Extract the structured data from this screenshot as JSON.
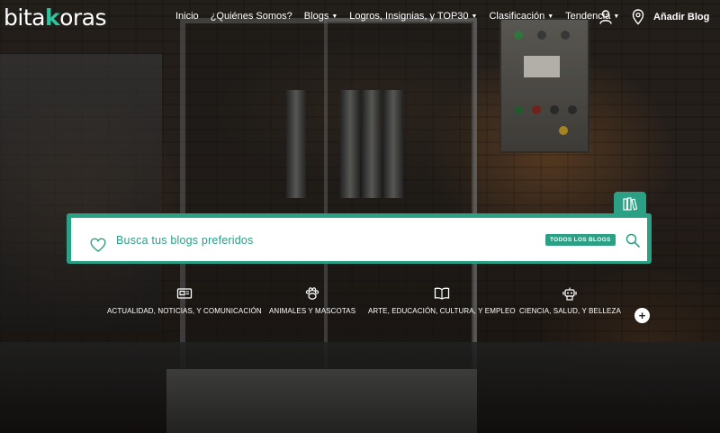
{
  "brand": {
    "logo_prefix": "bita",
    "logo_accent": "k",
    "logo_suffix": "oras",
    "accent_color": "#2ba084"
  },
  "nav": {
    "items": [
      {
        "label": "Inicio",
        "has_dropdown": false
      },
      {
        "label": "¿Quiénes Somos?",
        "has_dropdown": false
      },
      {
        "label": "Blogs",
        "has_dropdown": true
      },
      {
        "label": "Logros, Insignias, y TOP30",
        "has_dropdown": true
      },
      {
        "label": "Clasificación",
        "has_dropdown": true
      },
      {
        "label": "Tendencia",
        "has_dropdown": true
      }
    ],
    "user_icon": "user-icon",
    "add_blog_label": "Añadir Blog",
    "add_blog_icon": "map-pin-icon"
  },
  "search": {
    "placeholder": "Busca tus blogs preferidos",
    "filter_label": "TODOS LOS BLOGS",
    "left_icon": "heart-icon",
    "right_icon": "search-icon",
    "tab_icon": "books-icon"
  },
  "categories": [
    {
      "label": "ACTUALIDAD, NOTICIAS, Y COMUNICACIÓN",
      "icon": "newspaper-icon"
    },
    {
      "label": "ANIMALES Y MASCOTAS",
      "icon": "paw-icon"
    },
    {
      "label": "ARTE, EDUCACIÓN, CULTURA, Y EMPLEO",
      "icon": "book-icon"
    },
    {
      "label": "CIENCIA, SALUD, Y BELLEZA",
      "icon": "robot-icon"
    }
  ],
  "more_label": "+"
}
